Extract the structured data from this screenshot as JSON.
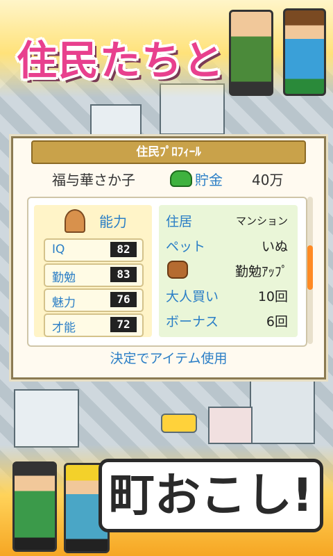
{
  "banner": {
    "headline": "住民たちと",
    "slogan": "町おこし!"
  },
  "panel": {
    "title": "住民ﾌﾟﾛﾌｨｰﾙ",
    "resident_name": "福与華さか子",
    "savings_label": "貯金",
    "savings_value": "40万",
    "stats_title": "能力",
    "stats": [
      {
        "label": "IQ",
        "value": "82"
      },
      {
        "label": "勤勉",
        "value": "83"
      },
      {
        "label": "魅力",
        "value": "76"
      },
      {
        "label": "才能",
        "value": "72"
      }
    ],
    "info": [
      {
        "label": "住居",
        "value": "マンション"
      },
      {
        "label": "ペット",
        "value": "いぬ"
      },
      {
        "label": "",
        "value": "勤勉ｱｯﾌﾟ"
      },
      {
        "label": "大人買い",
        "value": "10回"
      },
      {
        "label": "ボーナス",
        "value": "6回"
      }
    ],
    "footer": "決定でアイテム使用"
  },
  "colors": {
    "accent_blue": "#2a7ec6",
    "headline_pink": "#e8408e",
    "scroll_orange": "#ff8a24"
  },
  "icons": [
    "money-bag-icon",
    "resident-avatar-icon",
    "dog-icon"
  ]
}
